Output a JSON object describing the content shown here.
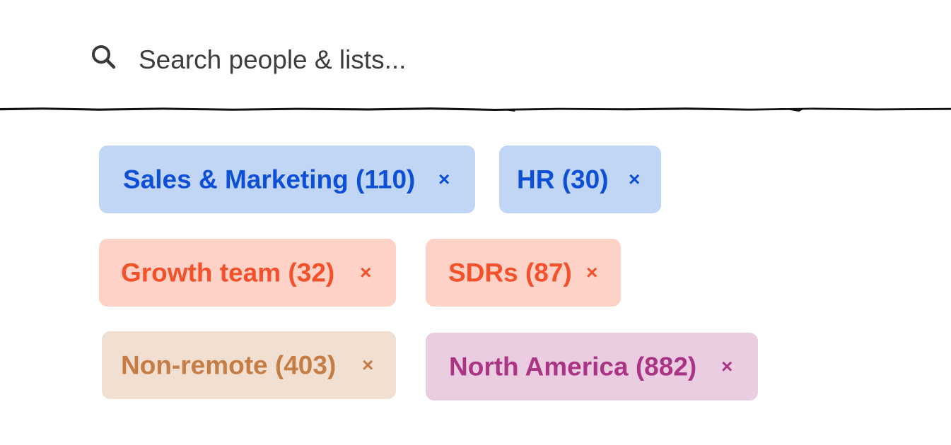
{
  "search": {
    "placeholder": "Search people & lists...",
    "icon": "search-icon"
  },
  "chips": [
    {
      "label": "Sales & Marketing (110)",
      "close": "×",
      "color": "#0d4fd6",
      "bg": "#c1d6f5"
    },
    {
      "label": "HR (30)",
      "close": "×",
      "color": "#0d4fd6",
      "bg": "#c1d6f5"
    },
    {
      "label": "Growth team (32)",
      "close": "×",
      "color": "#f4502a",
      "bg": "#ffd2c8"
    },
    {
      "label": "SDRs (87)",
      "close": "×",
      "color": "#f4502a",
      "bg": "#ffd2c8"
    },
    {
      "label": "Non-remote (403)",
      "close": "×",
      "color": "#c57d45",
      "bg": "#f1dfd1"
    },
    {
      "label": "North America (882)",
      "close": "×",
      "color": "#ab3585",
      "bg": "#ebcde2"
    }
  ]
}
